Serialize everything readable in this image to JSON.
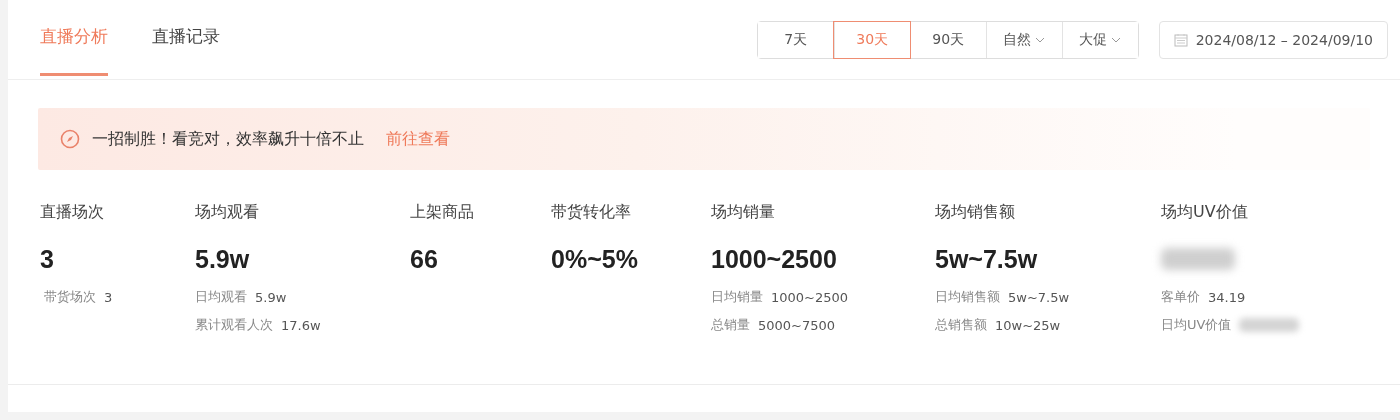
{
  "tabs": [
    {
      "label": "直播分析",
      "selected": true
    },
    {
      "label": "直播记录",
      "selected": false
    }
  ],
  "range_buttons": [
    {
      "label": "7天",
      "kind": "option",
      "selected": false
    },
    {
      "label": "30天",
      "kind": "option",
      "selected": true
    },
    {
      "label": "90天",
      "kind": "option",
      "selected": false
    },
    {
      "label": "自然",
      "kind": "dropdown",
      "selected": false
    },
    {
      "label": "大促",
      "kind": "dropdown",
      "selected": false
    }
  ],
  "date_range": {
    "start": "2024/08/12",
    "separator": "–",
    "end": "2024/09/10"
  },
  "banner": {
    "text": "一招制胜！看竞对，效率飙升十倍不止",
    "link": "前往查看"
  },
  "metrics": [
    {
      "label": "直播场次",
      "value": "3",
      "blurred": false,
      "details": [
        {
          "label": "带货场次",
          "value": "3",
          "blurred": false
        }
      ]
    },
    {
      "label": "场均观看",
      "value": "5.9w",
      "blurred": false,
      "details": [
        {
          "label": "日均观看",
          "value": "5.9w",
          "blurred": false
        },
        {
          "label": "累计观看人次",
          "value": "17.6w",
          "blurred": false
        }
      ]
    },
    {
      "label": "上架商品",
      "value": "66",
      "blurred": false
    },
    {
      "label": "带货转化率",
      "value": "0%~5%",
      "blurred": false
    },
    {
      "label": "场均销量",
      "value": "1000~2500",
      "blurred": false,
      "details": [
        {
          "label": "日均销量",
          "value": "1000~2500",
          "blurred": false
        },
        {
          "label": "总销量",
          "value": "5000~7500",
          "blurred": false
        }
      ]
    },
    {
      "label": "场均销售额",
      "value": "5w~7.5w",
      "blurred": false,
      "details": [
        {
          "label": "日均销售额",
          "value": "5w~7.5w",
          "blurred": false
        },
        {
          "label": "总销售额",
          "value": "10w~25w",
          "blurred": false
        }
      ]
    },
    {
      "label": "场均UV价值",
      "blurred": true,
      "details": [
        {
          "label": "客单价",
          "value": "34.19",
          "blurred": false
        },
        {
          "label": "日均UV价值",
          "blurred": true
        }
      ]
    }
  ]
}
